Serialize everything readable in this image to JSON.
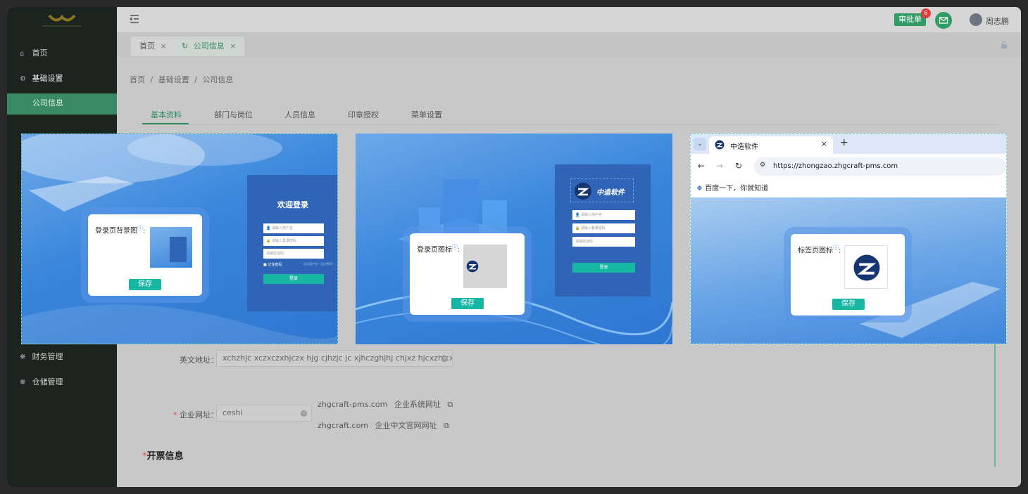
{
  "sidebar": {
    "items": [
      {
        "label": "首页",
        "icon": "home-icon"
      },
      {
        "label": "基础设置",
        "icon": "gear-icon"
      },
      {
        "label": "公司信息"
      },
      {
        "label": "财务管理",
        "icon": "gear-icon"
      },
      {
        "label": "仓储管理",
        "icon": "gear-icon"
      }
    ]
  },
  "topbar": {
    "approval_label": "审批单",
    "approval_badge": "6",
    "user_name": "周志鹏"
  },
  "tabs": [
    {
      "label": "首页"
    },
    {
      "label": "公司信息"
    }
  ],
  "breadcrumb": [
    "首页",
    "/",
    "基础设置",
    "/",
    "公司信息"
  ],
  "subtabs": [
    "基本资料",
    "部门与岗位",
    "人员信息",
    "印章授权",
    "菜单设置"
  ],
  "card1": {
    "login_title": "欢迎登录",
    "username_ph": "请输入用户名",
    "password_ph": "请输入登录密码",
    "captcha_ph": "请输验证码",
    "remember": "记住密码",
    "forgot": "忘记用户名？忘记密码？",
    "login_btn": "登录",
    "popup_label": "登录页背景图",
    "save": "保存"
  },
  "card2": {
    "brand": "中造软件",
    "username_ph": "请输入用户名",
    "password_ph": "请输入登录密码",
    "captcha_ph": "请输验证码",
    "login_btn": "登录",
    "popup_label": "登录页图标",
    "save": "保存"
  },
  "card3": {
    "tab_title": "中造软件",
    "url": "https://zhongzao.zhgcraft-pms.com",
    "bookmark": "百度一下，你就知道",
    "popup_label": "标签页图标",
    "save": "保存"
  },
  "form": {
    "en_address_label": "英文地址：",
    "en_address_value": "xchzhjc  xczxczxhjczx hjg cjhzjc jc xjhczghjhj chjxz hjcxzhjcxzh",
    "website_label": "企业网址：",
    "website_value": "ceshi",
    "links": [
      {
        "domain": "zhgcraft-pms.com",
        "desc": "企业系统网址"
      },
      {
        "domain": "zhgcraft.com",
        "desc": "企业中文官网网址"
      }
    ],
    "invoice_title": "开票信息"
  },
  "colors": {
    "accent": "#2f8a5e",
    "teal": "#18b7a3",
    "sidebar": "#1c2420"
  }
}
